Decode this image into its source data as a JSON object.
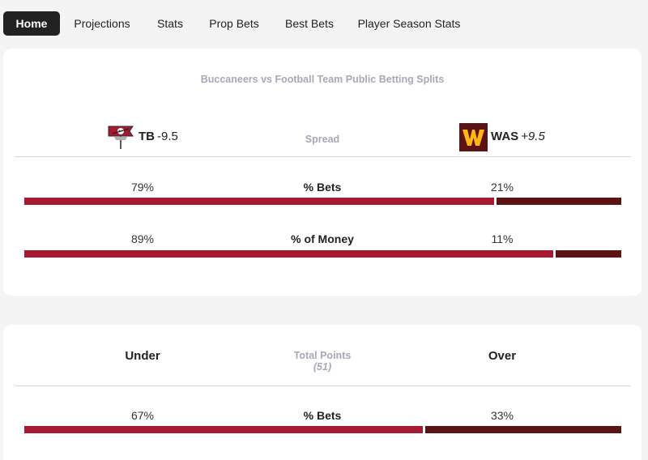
{
  "nav": {
    "items": [
      {
        "label": "Home",
        "active": true
      },
      {
        "label": "Projections",
        "active": false
      },
      {
        "label": "Stats",
        "active": false
      },
      {
        "label": "Prop Bets",
        "active": false
      },
      {
        "label": "Best Bets",
        "active": false
      },
      {
        "label": "Player Season Stats",
        "active": false
      }
    ]
  },
  "spread_card": {
    "title": "Buccaneers vs Football Team Public Betting Splits",
    "center_label": "Spread",
    "away": {
      "abbr": "TB",
      "line": "-9.5",
      "logo": "buccaneers-flag-logo",
      "color": "#a71930"
    },
    "home": {
      "abbr": "WAS",
      "line": "+9.5",
      "logo": "washington-w-logo",
      "color": "#5c1313"
    },
    "rows": [
      {
        "metric": "% Bets",
        "left_pct": "79%",
        "right_pct": "21%",
        "left_value": 79,
        "right_value": 21
      },
      {
        "metric": "% of Money",
        "left_pct": "89%",
        "right_pct": "11%",
        "left_value": 89,
        "right_value": 11
      }
    ]
  },
  "total_card": {
    "left_label": "Under",
    "right_label": "Over",
    "center_label": "Total Points",
    "center_sub": "(51)",
    "rows": [
      {
        "metric": "% Bets",
        "left_pct": "67%",
        "right_pct": "33%",
        "left_value": 67,
        "right_value": 33
      }
    ]
  },
  "colors": {
    "left_bar": "#a71930",
    "right_bar": "#5c1313",
    "muted_text": "#a8a8b6"
  }
}
